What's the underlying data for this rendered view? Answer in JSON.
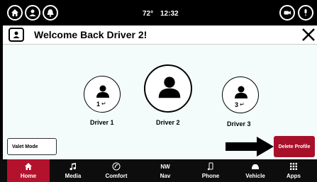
{
  "status_bar": {
    "temperature": "72°",
    "time": "12:32",
    "left_icons": [
      "home-icon",
      "user-icon",
      "bell-icon"
    ],
    "right_icons": [
      "camera-icon",
      "microphone-icon"
    ]
  },
  "title_bar": {
    "title": "Welcome Back Driver 2!",
    "close_icon": "close-icon"
  },
  "drivers": [
    {
      "label": "Driver 1",
      "seat_number": "1",
      "selected": false
    },
    {
      "label": "Driver 2",
      "seat_number": "",
      "selected": true
    },
    {
      "label": "Driver 3",
      "seat_number": "3",
      "selected": false
    }
  ],
  "buttons": {
    "valet_mode": "Valet Mode",
    "delete_profile": "Delete Profile"
  },
  "nav": {
    "items": [
      {
        "label": "Home",
        "icon": "home-icon",
        "active": true
      },
      {
        "label": "Media",
        "icon": "music-note-icon",
        "active": false
      },
      {
        "label": "Comfort",
        "icon": "comfort-icon",
        "active": false
      },
      {
        "label": "Nav",
        "icon": "compass-icon",
        "active": false,
        "badge": "NW"
      },
      {
        "label": "Phone",
        "icon": "phone-icon",
        "active": false
      },
      {
        "label": "Vehicle",
        "icon": "car-icon",
        "active": false
      },
      {
        "label": "Apps",
        "icon": "apps-grid-icon",
        "active": false
      }
    ]
  },
  "colors": {
    "accent": "#b3122d",
    "delete": "#a8102a",
    "background": "#f3fbfb"
  }
}
